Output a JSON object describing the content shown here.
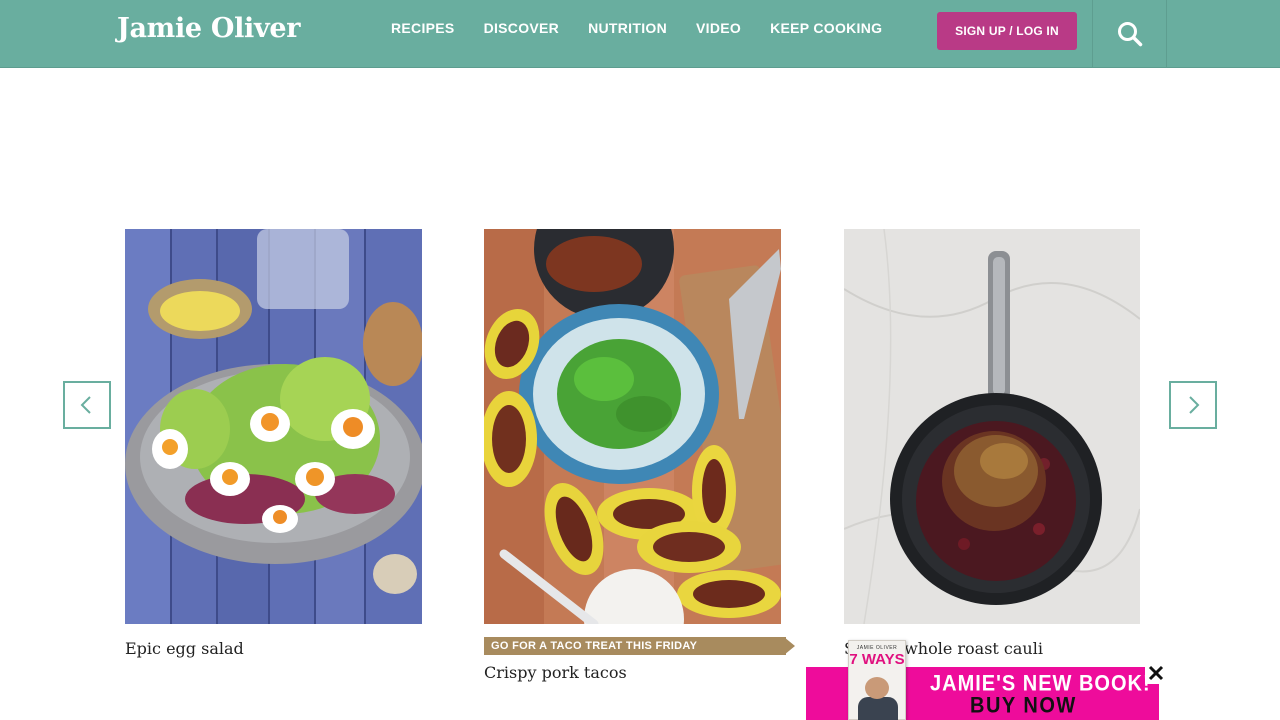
{
  "header": {
    "logo_text": "Jamie Oliver",
    "nav": [
      {
        "label": "RECIPES"
      },
      {
        "label": "DISCOVER"
      },
      {
        "label": "NUTRITION"
      },
      {
        "label": "VIDEO"
      },
      {
        "label": "KEEP COOKING"
      }
    ],
    "signup_label": "SIGN UP / LOG IN",
    "search_icon": "search-icon",
    "bar_color": "#69ae9f",
    "signup_color": "#b93a86"
  },
  "carousel": {
    "prev_icon": "chevron-left-icon",
    "next_icon": "chevron-right-icon",
    "cards": [
      {
        "title": "Epic egg salad",
        "image": "egg-salad-photo"
      },
      {
        "title": "Crispy pork tacos",
        "tag": "GO FOR A TACO TREAT THIS FRIDAY",
        "image": "pork-tacos-photo"
      },
      {
        "title": "Spiced whole roast cauli",
        "image": "roast-cauliflower-photo"
      }
    ]
  },
  "ad": {
    "book_author": "JAMIE OLIVER",
    "book_title": "7 WAYS",
    "line1": "JAMIE'S NEW BOOK!",
    "line2": "BUY NOW",
    "close_icon": "close-icon",
    "bg_color": "#ee0c9b"
  }
}
